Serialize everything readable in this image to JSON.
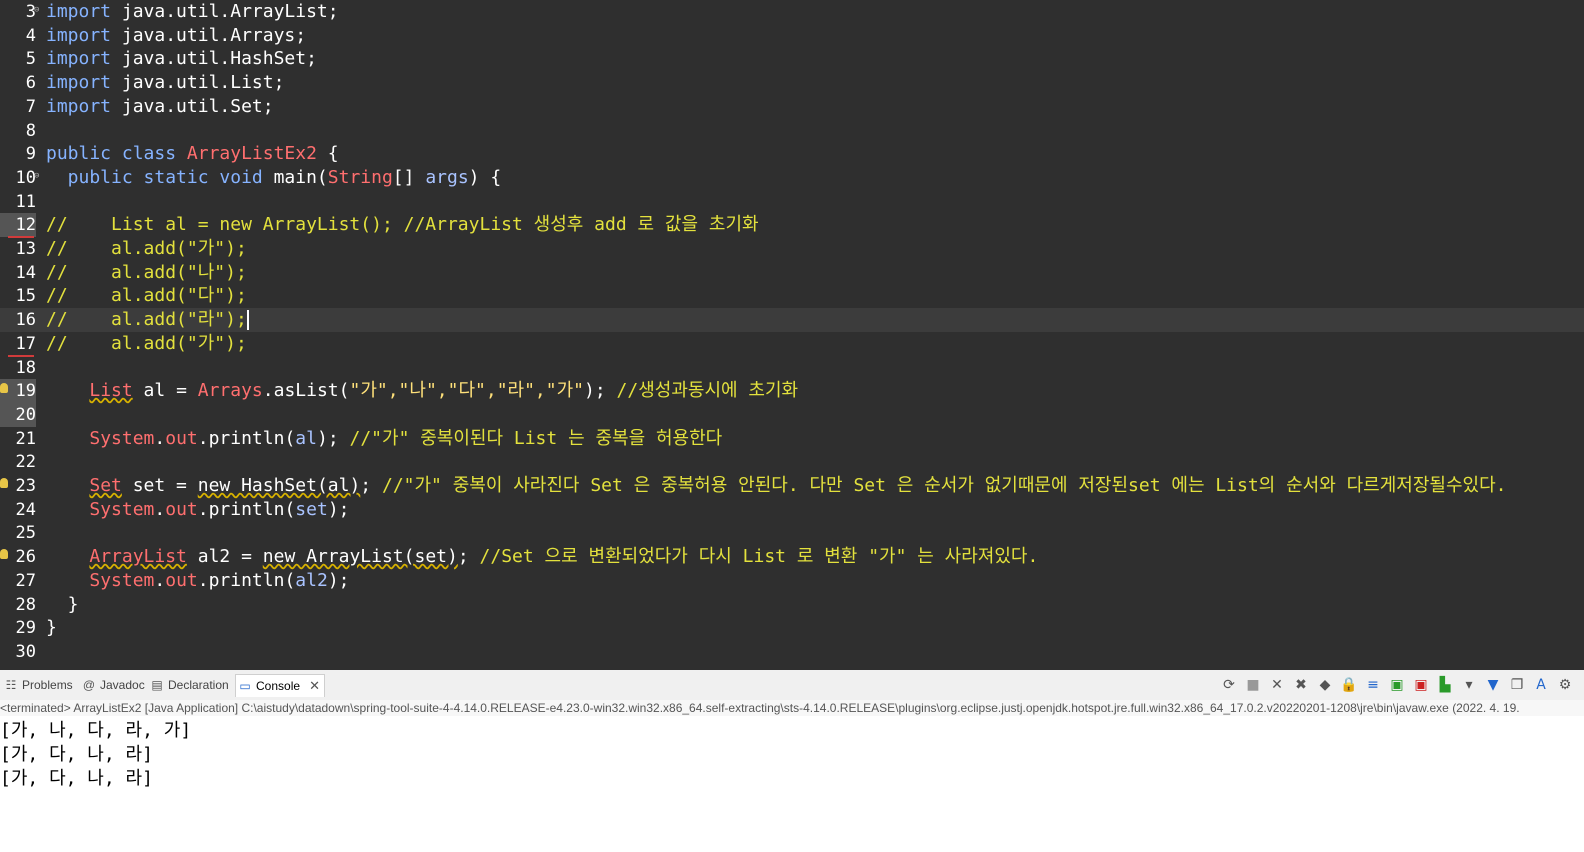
{
  "editor": {
    "lines": [
      {
        "num": "3",
        "segments": [
          {
            "t": "import",
            "c": "kw"
          },
          {
            "t": " java.util.ArrayList;"
          }
        ]
      },
      {
        "num": "4",
        "segments": [
          {
            "t": "import",
            "c": "kw"
          },
          {
            "t": " java.util.Arrays;"
          }
        ]
      },
      {
        "num": "5",
        "segments": [
          {
            "t": "import",
            "c": "kw"
          },
          {
            "t": " java.util.HashSet;"
          }
        ]
      },
      {
        "num": "6",
        "segments": [
          {
            "t": "import",
            "c": "kw"
          },
          {
            "t": " java.util.List;"
          }
        ]
      },
      {
        "num": "7",
        "segments": [
          {
            "t": "import",
            "c": "kw"
          },
          {
            "t": " java.util.Set;"
          }
        ]
      },
      {
        "num": "8",
        "segments": []
      },
      {
        "num": "9",
        "segments": [
          {
            "t": "public class ",
            "c": "kw"
          },
          {
            "t": "ArrayListEx2",
            "c": "type"
          },
          {
            "t": " {"
          }
        ]
      },
      {
        "num": "10",
        "segments": [
          {
            "t": "  public static void ",
            "c": "kw"
          },
          {
            "t": "main("
          },
          {
            "t": "String",
            "c": "type"
          },
          {
            "t": "[] "
          },
          {
            "t": "args",
            "c": "var"
          },
          {
            "t": ") {"
          }
        ]
      },
      {
        "num": "11",
        "segments": []
      },
      {
        "num": "12",
        "segments": [
          {
            "t": "//    List al = new ArrayList(); //ArrayList 생성후 add 로 값을 초기화",
            "c": "cm"
          }
        ]
      },
      {
        "num": "13",
        "segments": [
          {
            "t": "//    al.add(\"가\");",
            "c": "cm"
          }
        ]
      },
      {
        "num": "14",
        "segments": [
          {
            "t": "//    al.add(\"나\");",
            "c": "cm"
          }
        ]
      },
      {
        "num": "15",
        "segments": [
          {
            "t": "//    al.add(\"다\");",
            "c": "cm"
          }
        ]
      },
      {
        "num": "16",
        "segments": [
          {
            "t": "//    al.add(\"라\");",
            "c": "cm"
          }
        ]
      },
      {
        "num": "17",
        "segments": [
          {
            "t": "//    al.add(\"가\");",
            "c": "cm"
          }
        ]
      },
      {
        "num": "18",
        "segments": []
      },
      {
        "num": "19",
        "segments": [
          {
            "t": "    "
          },
          {
            "t": "List",
            "c": "type warn"
          },
          {
            "t": " al = "
          },
          {
            "t": "Arrays",
            "c": "type"
          },
          {
            "t": ".asList("
          },
          {
            "t": "\"가\",\"나\",\"다\",\"라\",\"가\"",
            "c": "str"
          },
          {
            "t": "); "
          },
          {
            "t": "//생성과동시에 초기화",
            "c": "cm"
          }
        ]
      },
      {
        "num": "20",
        "segments": []
      },
      {
        "num": "21",
        "segments": [
          {
            "t": "    "
          },
          {
            "t": "System",
            "c": "type"
          },
          {
            "t": "."
          },
          {
            "t": "out",
            "c": "field"
          },
          {
            "t": ".println("
          },
          {
            "t": "al",
            "c": "var"
          },
          {
            "t": "); "
          },
          {
            "t": "//\"가\" 중복이된다 List 는 중복을 허용한다",
            "c": "cm"
          }
        ]
      },
      {
        "num": "22",
        "segments": []
      },
      {
        "num": "23",
        "segments": [
          {
            "t": "    "
          },
          {
            "t": "Set",
            "c": "type warn"
          },
          {
            "t": " set = "
          },
          {
            "t": "new HashSet(al)",
            "c": "warn"
          },
          {
            "t": "; "
          },
          {
            "t": "//\"가\" 중복이 사라진다 Set 은 중복허용 안된다. 다만 Set 은 순서가 없기때문에 저장된set 에는 List의 순서와 다르게저장될수있다.",
            "c": "cm"
          }
        ]
      },
      {
        "num": "24",
        "segments": [
          {
            "t": "    "
          },
          {
            "t": "System",
            "c": "type"
          },
          {
            "t": "."
          },
          {
            "t": "out",
            "c": "field"
          },
          {
            "t": ".println("
          },
          {
            "t": "set",
            "c": "var"
          },
          {
            "t": ");"
          }
        ]
      },
      {
        "num": "25",
        "segments": []
      },
      {
        "num": "26",
        "segments": [
          {
            "t": "    "
          },
          {
            "t": "ArrayList",
            "c": "type warn"
          },
          {
            "t": " al2 = "
          },
          {
            "t": "new ArrayList(set)",
            "c": "warn"
          },
          {
            "t": "; "
          },
          {
            "t": "//Set 으로 변환되었다가 다시 List 로 변환 \"가\" 는 사라져있다.",
            "c": "cm"
          }
        ]
      },
      {
        "num": "27",
        "segments": [
          {
            "t": "    "
          },
          {
            "t": "System",
            "c": "type"
          },
          {
            "t": "."
          },
          {
            "t": "out",
            "c": "field"
          },
          {
            "t": ".println("
          },
          {
            "t": "al2",
            "c": "var"
          },
          {
            "t": ");"
          }
        ]
      },
      {
        "num": "28",
        "segments": [
          {
            "t": "  }"
          }
        ]
      },
      {
        "num": "29",
        "segments": [
          {
            "t": "}"
          }
        ]
      },
      {
        "num": "30",
        "segments": []
      }
    ]
  },
  "panel": {
    "tabs": {
      "problems": "Problems",
      "javadoc": "Javadoc",
      "declaration": "Declaration",
      "console": "Console"
    },
    "status": "<terminated> ArrayListEx2 [Java Application] C:\\aistudy\\datadown\\spring-tool-suite-4-4.14.0.RELEASE-e4.23.0-win32.win32.x86_64.self-extracting\\sts-4.14.0.RELEASE\\plugins\\org.eclipse.justj.openjdk.hotspot.jre.full.win32.x86_64_17.0.2.v20220201-1208\\jre\\bin\\javaw.exe  (2022. 4. 19.",
    "output": [
      "[가, 나, 다, 라, 가]",
      "[가, 다, 나, 라]",
      "[가, 다, 나, 라]"
    ]
  }
}
